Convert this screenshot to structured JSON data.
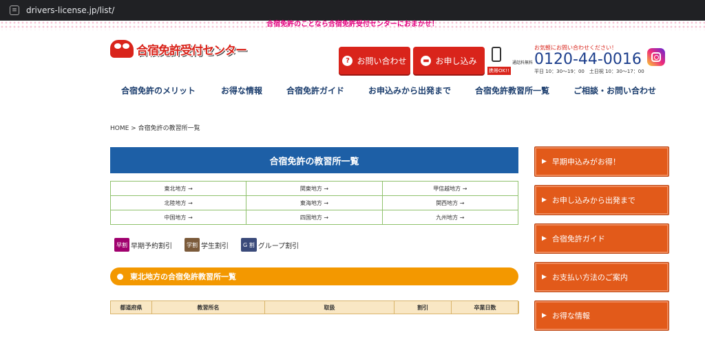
{
  "browser": {
    "url": "drivers-license.jp/list/"
  },
  "tagline": "合宿免許のことなら合宿免許受付センターにおまかせ！",
  "logo": {
    "text": "合宿免許受付センター"
  },
  "header": {
    "inquiry_label": "お問い合わせ",
    "apply_label": "お申し込み",
    "mobile_ok": "携帯OK!!",
    "free_dial": "通話料無料",
    "call_prompt": "お気軽にお問い合わせください！",
    "phone_number": "0120-44-0016",
    "hours": "平日 10：30～19：00　土日祝 10：30～17：00"
  },
  "nav": [
    "合宿免許のメリット",
    "お得な情報",
    "合宿免許ガイド",
    "お申込みから出発まで",
    "合宿免許教習所一覧",
    "ご相談・お問い合わせ"
  ],
  "breadcrumb": "HOME > 合宿免許の教習所一覧",
  "main": {
    "title": "合宿免許の教習所一覧",
    "regions": [
      "東北地方 →",
      "関東地方 →",
      "甲信越地方 →",
      "北陸地方 →",
      "東海地方 →",
      "関西地方 →",
      "中国地方 →",
      "四国地方 →",
      "九州地方 →"
    ],
    "legend": [
      {
        "badge": "早割",
        "label": "早期予約割引",
        "color": "#a0006e"
      },
      {
        "badge": "学割",
        "label": "学生割引",
        "color": "#7b5a3a"
      },
      {
        "badge": "G 割",
        "label": "グループ割引",
        "color": "#3a4a7a"
      }
    ],
    "section_title": "東北地方の合宿免許教習所一覧",
    "table_headers": [
      "都道府県",
      "教習所名",
      "取扱",
      "割引",
      "卒業日数"
    ]
  },
  "sidebar": [
    "早期申込みがお得！",
    "お申し込みから出発まで",
    "合宿免許ガイド",
    "お支払い方法のご案内",
    "お得な情報"
  ]
}
